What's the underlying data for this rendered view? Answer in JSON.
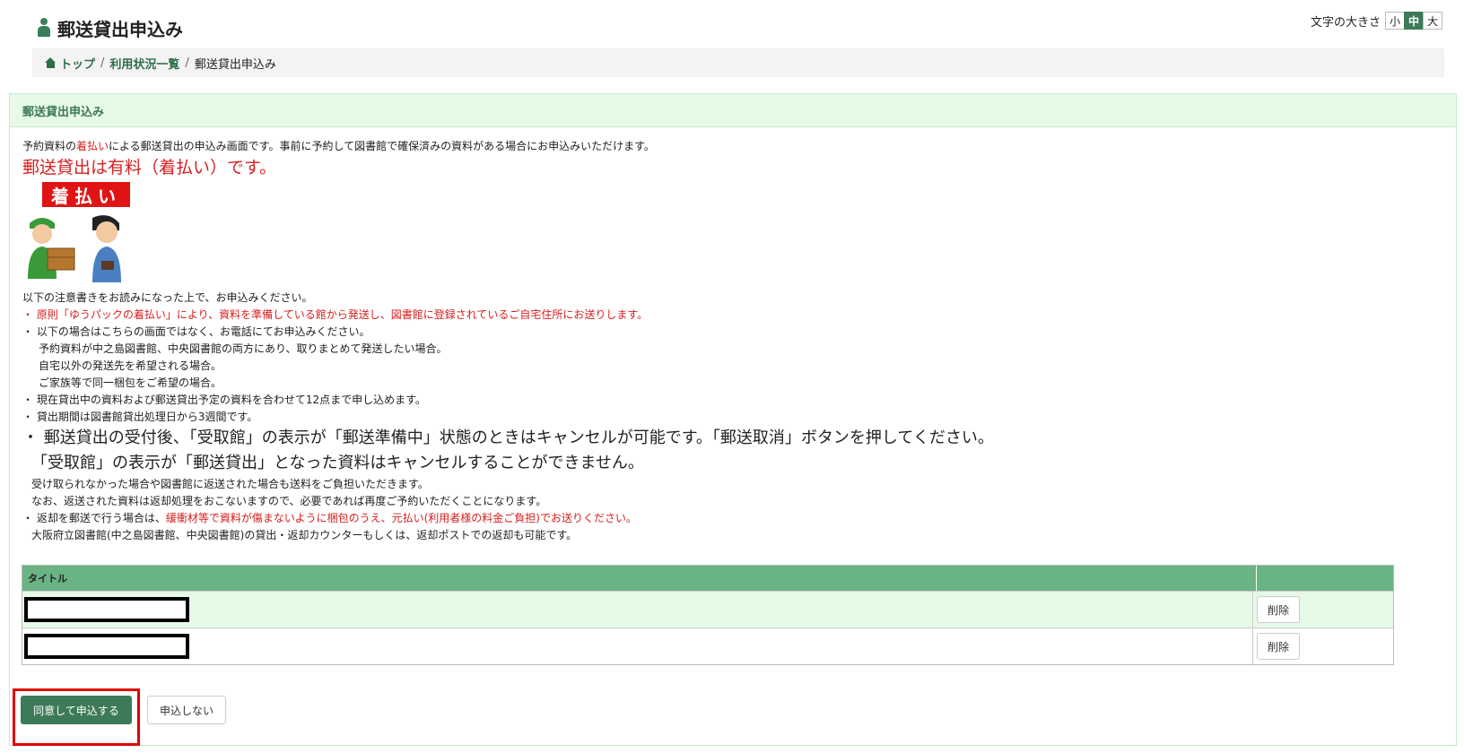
{
  "header": {
    "title": "郵送貸出申込み",
    "font_size_label": "文字の大きさ",
    "font_sizes": [
      "小",
      "中",
      "大"
    ],
    "active_font_size": "中"
  },
  "breadcrumb": {
    "items": [
      "トップ",
      "利用状況一覧"
    ],
    "current": "郵送貸出申込み"
  },
  "panel": {
    "title": "郵送貸出申込み",
    "intro_prefix": "予約資料の",
    "intro_highlight": "着払い",
    "intro_suffix": "による郵送貸出の申込み画面です。事前に予約して図書館で確保済みの資料がある場合にお申込みいただけます。",
    "paid_notice": "郵送貸出は有料（着払い）です。",
    "banner": "着払い",
    "notes": {
      "read_first": "以下の注意書きをお読みになった上で、お申込みください。",
      "n1": "・ 原則「ゆうパックの着払い」により、資料を準備している館から発送し、図書館に登録されているご自宅住所にお送りします。",
      "n2": "・ 以下の場合はこちらの画面ではなく、お電話にてお申込みください。",
      "n2a": "予約資料が中之島図書館、中央図書館の両方にあり、取りまとめて発送したい場合。",
      "n2b": "自宅以外の発送先を希望される場合。",
      "n2c": "ご家族等で同一梱包をご希望の場合。",
      "n3": "・ 現在貸出中の資料および郵送貸出予定の資料を合わせて12点まで申し込めます。",
      "n4": "・ 貸出期間は図書館貸出処理日から3週間です。",
      "n5": "・ 郵送貸出の受付後、「受取館」の表示が「郵送準備中」状態のときはキャンセルが可能です。「郵送取消」ボタンを押してください。",
      "n5b": "「受取館」の表示が「郵送貸出」となった資料はキャンセルすることができません。",
      "n5c": "受け取られなかった場合や図書館に返送された場合も送料をご負担いただきます。",
      "n5d": "なお、返送された資料は返却処理をおこないますので、必要であれば再度ご予約いただくことになります。",
      "n6_prefix": "・ 返却を郵送で行う場合は、",
      "n6_highlight": "緩衝材等で資料が傷まないように梱包のうえ、元払い(利用者様の料金ご負担)でお送りください。",
      "n6b": "大阪府立図書館(中之島図書館、中央図書館)の貸出・返却カウンターもしくは、返却ポストでの返却も可能です。"
    }
  },
  "table": {
    "col_title": "タイトル",
    "rows": [
      {
        "title": "",
        "delete_label": "削除"
      },
      {
        "title": "",
        "delete_label": "削除"
      }
    ]
  },
  "buttons": {
    "agree": "同意して申込する",
    "decline": "申込しない"
  },
  "colors": {
    "brand_green": "#3d7a57",
    "table_header": "#6ab385",
    "panel_header_bg": "#e7f9e7",
    "notice_red": "#d62020",
    "focus_red": "#e00000"
  }
}
